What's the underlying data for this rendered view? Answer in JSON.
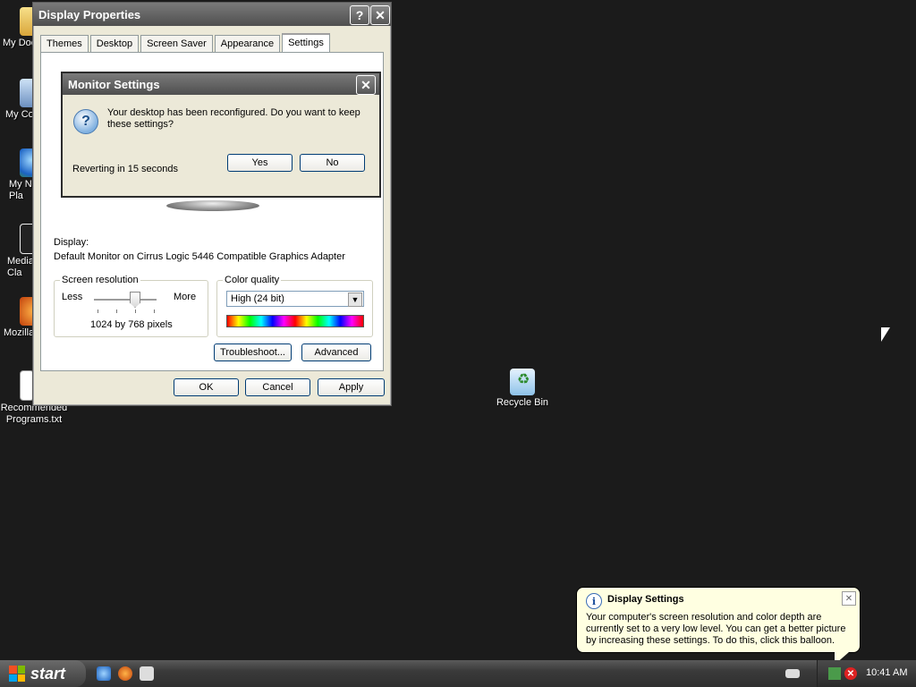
{
  "desktop": {
    "icons": [
      {
        "label": "My Doc"
      },
      {
        "label": "My Co"
      },
      {
        "label": "My N\nPla"
      },
      {
        "label": "Media\nCla"
      },
      {
        "label": "Mozilla"
      },
      {
        "label": "Recommended\nPrograms.txt"
      },
      {
        "label": "Recycle Bin"
      }
    ]
  },
  "display_properties": {
    "title": "Display Properties",
    "help_label": "?",
    "close_label": "✕",
    "tabs": [
      {
        "label": "Themes"
      },
      {
        "label": "Desktop"
      },
      {
        "label": "Screen Saver"
      },
      {
        "label": "Appearance"
      },
      {
        "label": "Settings"
      }
    ],
    "display_label": "Display:",
    "display_value": "Default Monitor on Cirrus Logic 5446 Compatible Graphics Adapter",
    "screen_resolution": {
      "title": "Screen resolution",
      "less": "Less",
      "more": "More",
      "value": "1024 by 768 pixels"
    },
    "color_quality": {
      "title": "Color quality",
      "selected": "High (24 bit)"
    },
    "troubleshoot_label": "Troubleshoot...",
    "advanced_label": "Advanced",
    "ok_label": "OK",
    "cancel_label": "Cancel",
    "apply_label": "Apply"
  },
  "monitor_settings": {
    "title": "Monitor Settings",
    "close_label": "✕",
    "message": "Your desktop has been reconfigured.  Do you want to keep these settings?",
    "countdown": "Reverting in 15 seconds",
    "yes_label": "Yes",
    "no_label": "No"
  },
  "taskbar": {
    "start_label": "start",
    "clock": "10:41 AM"
  },
  "balloon": {
    "title": "Display Settings",
    "message": "Your computer's screen resolution and color depth are currently set to a very low level. You can get a better picture by increasing these settings. To do this, click this balloon.",
    "close_label": "✕"
  }
}
